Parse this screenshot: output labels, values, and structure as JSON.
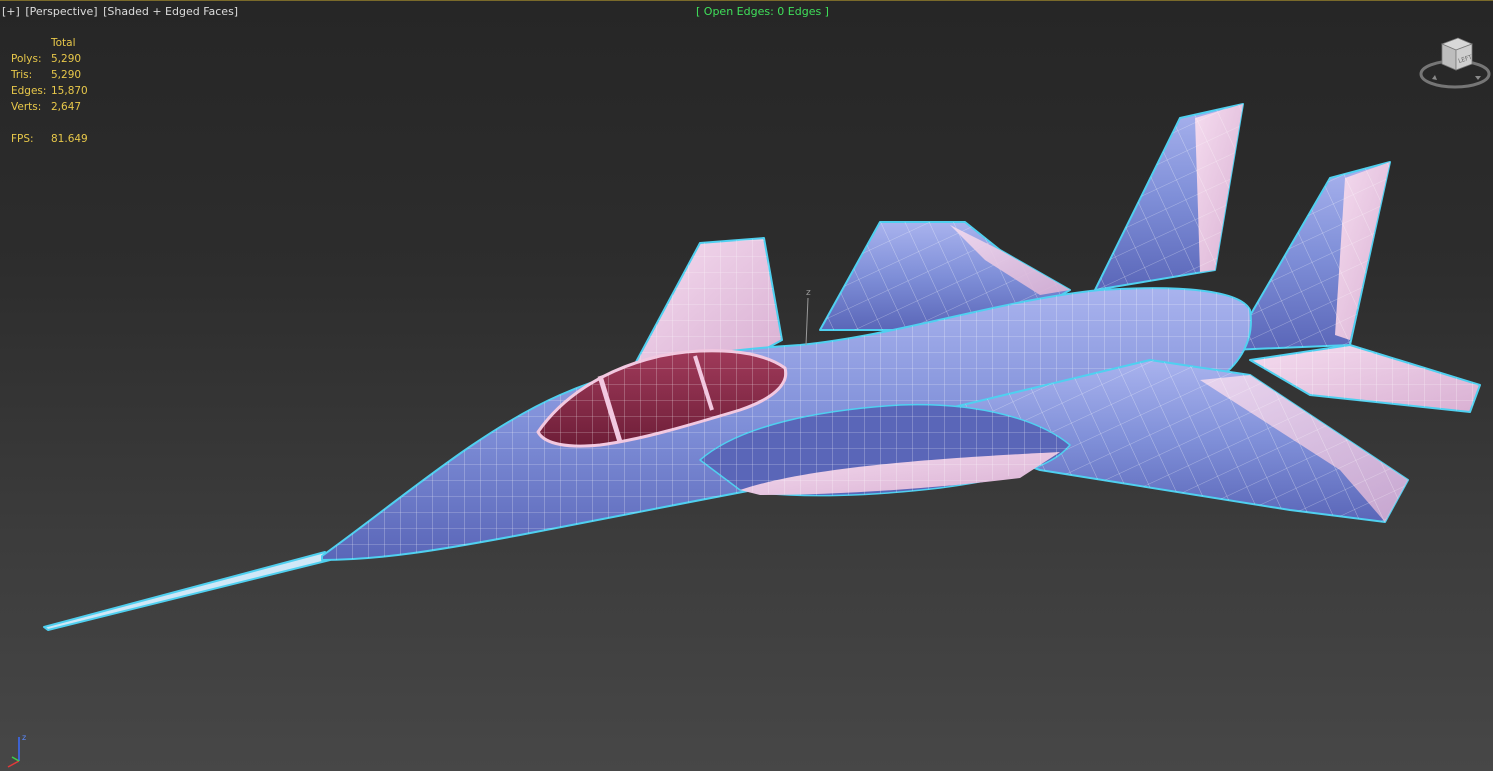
{
  "viewport": {
    "label_plus": "[+]",
    "label_view": "[Perspective]",
    "label_shading": "[Shaded + Edged Faces]"
  },
  "status": {
    "open_edges": "[ Open Edges: 0 Edges ]"
  },
  "stats": {
    "header": "Total",
    "rows": [
      {
        "label": "Polys:",
        "value": "5,290"
      },
      {
        "label": "Tris:",
        "value": "5,290"
      },
      {
        "label": "Edges:",
        "value": "15,870"
      },
      {
        "label": "Verts:",
        "value": "2,647"
      }
    ],
    "fps_label": "FPS:",
    "fps_value": "81.649"
  },
  "viewcube": {
    "face_label": "LEFT",
    "icon": "viewcube-icon"
  },
  "axes": {
    "z_label": "z",
    "gizmo_icon": "axis-gizmo-icon"
  },
  "colors": {
    "status_green": "#3fe05a",
    "stats_yellow": "#e8c84a",
    "body_blue": "#7f8fd8",
    "body_pink": "#ecc8e6",
    "canopy_red": "#8a2a48",
    "selection_cyan": "#4fd0f0"
  }
}
